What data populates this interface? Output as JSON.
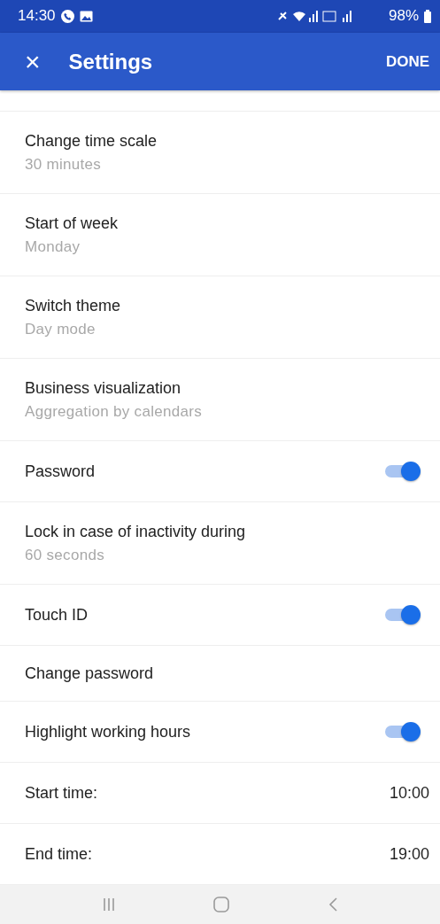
{
  "status_bar": {
    "time": "14:30",
    "battery": "98%"
  },
  "app_bar": {
    "close": "×",
    "title": "Settings",
    "action": "DONE"
  },
  "rows": [
    {
      "kind": "detail",
      "label": "Change time scale",
      "value": "30 minutes"
    },
    {
      "kind": "detail",
      "label": "Start of week",
      "value": "Monday"
    },
    {
      "kind": "detail",
      "label": "Switch theme",
      "value": "Day mode"
    },
    {
      "kind": "detail",
      "label": "Business visualization",
      "value": "Aggregation by calendars"
    },
    {
      "kind": "toggle",
      "label": "Password",
      "on": true
    },
    {
      "kind": "detail",
      "label": "Lock in case of inactivity during",
      "value": "60 seconds"
    },
    {
      "kind": "toggle",
      "label": "Touch ID",
      "on": true
    },
    {
      "kind": "plain",
      "label": "Change password"
    },
    {
      "kind": "toggle",
      "label": "Highlight working hours",
      "on": true
    },
    {
      "kind": "value",
      "label": "Start time:",
      "value": "10:00"
    },
    {
      "kind": "value",
      "label": "End time:",
      "value": "19:00"
    }
  ]
}
